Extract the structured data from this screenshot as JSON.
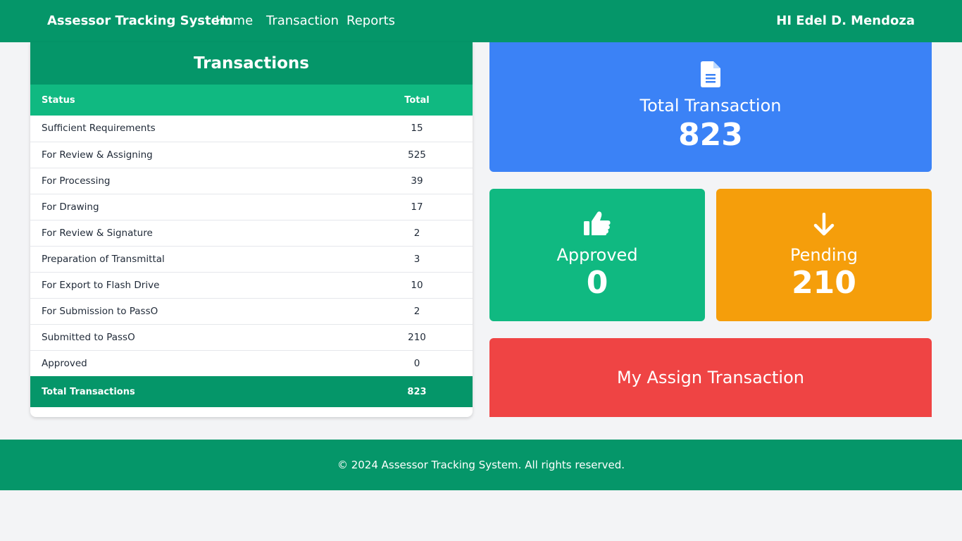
{
  "navbar": {
    "brand": "Assessor Tracking System",
    "links": [
      "Home",
      "Transaction",
      "Reports"
    ],
    "greeting": "HI Edel D. Mendoza"
  },
  "transactions_table": {
    "title": "Transactions",
    "headers": {
      "status": "Status",
      "total": "Total"
    },
    "rows": [
      {
        "status": "Sufficient Requirements",
        "total": "15"
      },
      {
        "status": "For Review & Assigning",
        "total": "525"
      },
      {
        "status": "For Processing",
        "total": "39"
      },
      {
        "status": "For Drawing",
        "total": "17"
      },
      {
        "status": "For Review & Signature",
        "total": "2"
      },
      {
        "status": "Preparation of Transmittal",
        "total": "3"
      },
      {
        "status": "For Export to Flash Drive",
        "total": "10"
      },
      {
        "status": "For Submission to PassO",
        "total": "2"
      },
      {
        "status": "Submitted to PassO",
        "total": "210"
      },
      {
        "status": "Approved",
        "total": "0"
      }
    ],
    "footer": {
      "label": "Total Transactions",
      "total": "823"
    }
  },
  "cards": {
    "total": {
      "label": "Total Transaction",
      "value": "823",
      "icon": "document-icon",
      "color": "#3b82f6"
    },
    "approved": {
      "label": "Approved",
      "value": "0",
      "icon": "thumbs-up-icon",
      "color": "#10b981"
    },
    "pending": {
      "label": "Pending",
      "value": "210",
      "icon": "arrow-down-icon",
      "color": "#f59e0b"
    },
    "assign": {
      "label": "My Assign Transaction",
      "color": "#ef4444"
    }
  },
  "footer": {
    "text": "© 2024 Assessor Tracking System. All rights reserved."
  },
  "colors": {
    "primary": "#059669",
    "header_row": "#10b981",
    "background": "#f3f4f6"
  }
}
